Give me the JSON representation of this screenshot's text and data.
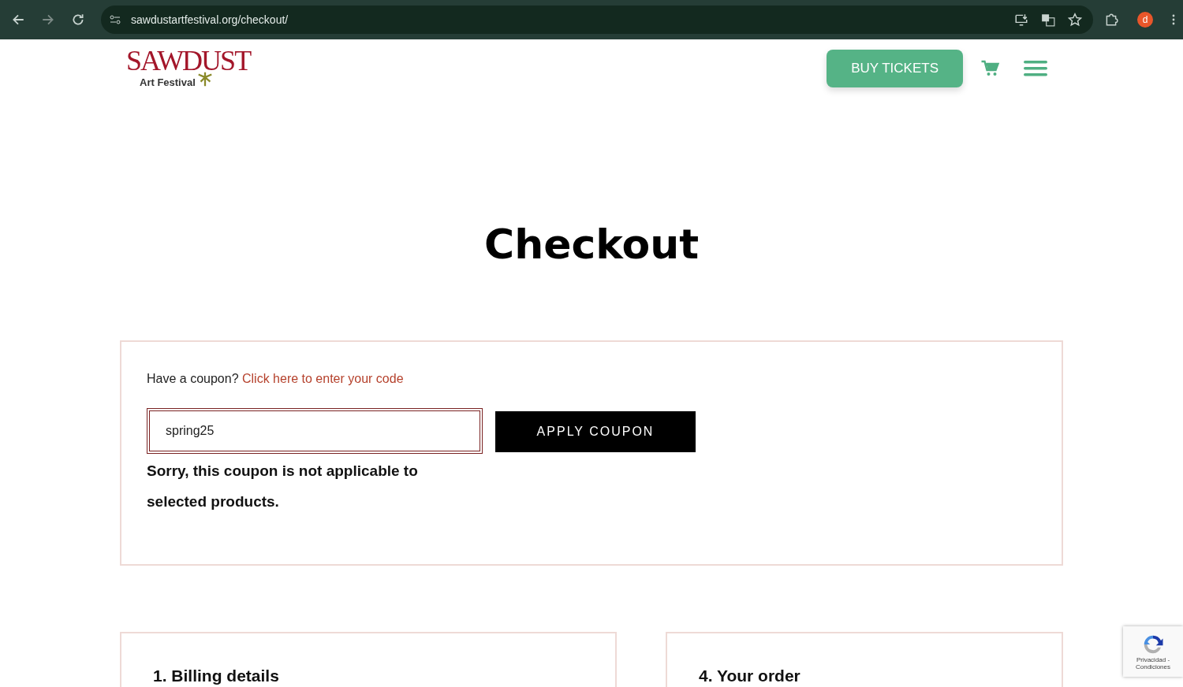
{
  "browser": {
    "url": "sawdustartfestival.org/checkout/",
    "profile_initial": "d"
  },
  "header": {
    "logo_title": "SAWDUST",
    "logo_subtitle": "Art Festival",
    "buy_button": "BUY TICKETS"
  },
  "page_title": "Checkout",
  "coupon": {
    "prompt": "Have a coupon?",
    "link": "Click here to enter your code",
    "value": "spring25",
    "invalid": true,
    "apply_button": "APPLY COUPON",
    "error": "Sorry, this coupon is not applicable to selected products."
  },
  "sections": [
    {
      "heading": "1. Billing details"
    },
    {
      "heading": "4. Your order"
    }
  ],
  "recaptcha": {
    "footer": "Privacidad - Condiciones"
  }
}
